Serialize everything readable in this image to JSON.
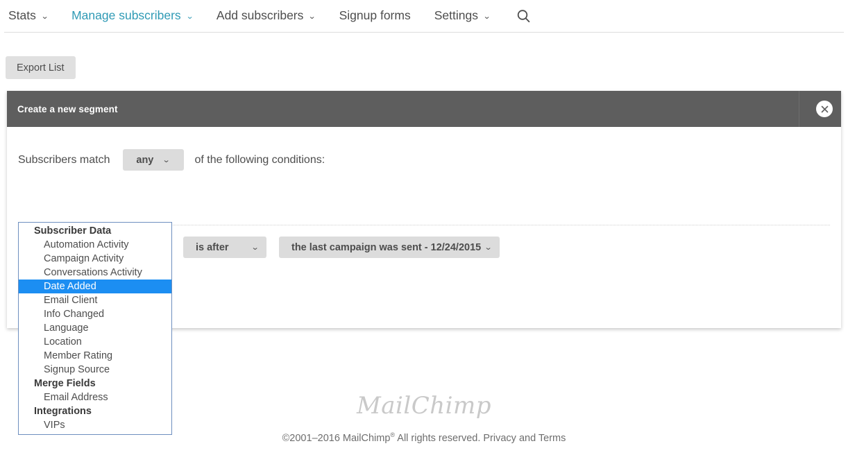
{
  "nav": {
    "items": [
      {
        "label": "Stats",
        "has_caret": true,
        "active": false
      },
      {
        "label": "Manage subscribers",
        "has_caret": true,
        "active": true
      },
      {
        "label": "Add subscribers",
        "has_caret": true,
        "active": false
      },
      {
        "label": "Signup forms",
        "has_caret": false,
        "active": false
      },
      {
        "label": "Settings",
        "has_caret": true,
        "active": false
      }
    ],
    "search_icon": "search-icon",
    "caret_glyph": "⌄",
    "active_color": "#2f9ab5",
    "text_color": "#4d4d4d"
  },
  "toolbar": {
    "export_label": "Export List"
  },
  "modal": {
    "title": "Create a new segment",
    "close_icon": "close-icon",
    "close_glyph": "✕",
    "header_bg": "#5e5e5e",
    "match_prefix": "Subscribers match",
    "match_suffix": "of the following conditions:",
    "match_value": "any",
    "condition": {
      "field_value": "Date Added",
      "operator_value": "is after",
      "value_value": "the last campaign was sent - 12/24/2015"
    },
    "caret_glyph": "⌄"
  },
  "field_dropdown": {
    "selected": "Date Added",
    "highlight_color": "#1c8ef2",
    "border_color": "#6e8fbf",
    "groups": [
      {
        "label": "Subscriber Data",
        "options": [
          "Automation Activity",
          "Campaign Activity",
          "Conversations Activity",
          "Date Added",
          "Email Client",
          "Info Changed",
          "Language",
          "Location",
          "Member Rating",
          "Signup Source"
        ]
      },
      {
        "label": "Merge Fields",
        "options": [
          "Email Address"
        ]
      },
      {
        "label": "Integrations",
        "options": [
          "VIPs"
        ]
      }
    ]
  },
  "footer": {
    "logo_text": "MailChimp",
    "copyright_prefix": "©2001–2016 MailChimp",
    "registered_mark": "®",
    "copyright_middle": " All rights reserved. ",
    "link_text": "Privacy and Terms"
  }
}
